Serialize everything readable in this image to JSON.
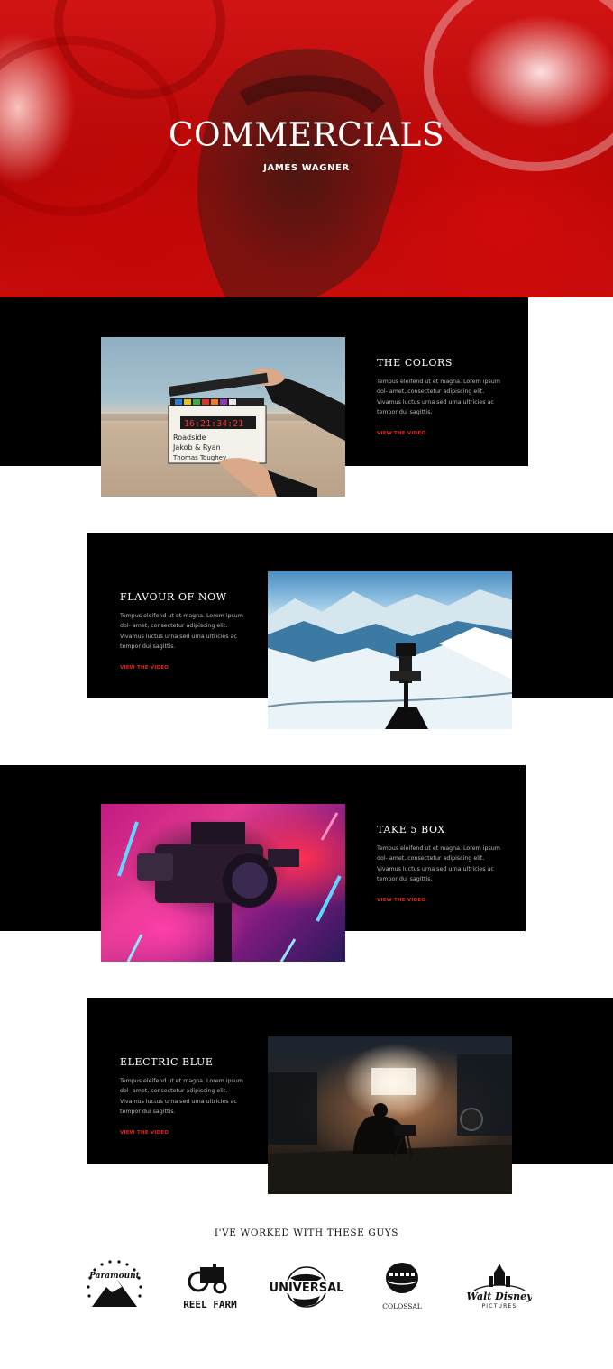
{
  "hero": {
    "title": "COMMERCIALS",
    "subtitle": "JAMES WAGNER"
  },
  "projects": [
    {
      "title": "THE COLORS",
      "text": "Tempus eleifend ut et magna. Lorem ipsum dol- amet, consectetur adipiscing elit. Vivamus luctus urna sed urna ultricies ac tempor dui sagittis.",
      "link": "VIEW THE VIDEO",
      "clapper_line1": "Roadside",
      "clapper_line2": "Jakob & Ryan",
      "clapper_line3": "Thomas Toughey",
      "clapper_time": "16:21:34:21"
    },
    {
      "title": "FLAVOUR OF NOW",
      "text": "Tempus eleifend ut et magna. Lorem ipsum dol- amet, consectetur adipiscing elit. Vivamus luctus urna sed urna ultricies ac tempor dui sagittis.",
      "link": "VIEW THE VIDEO"
    },
    {
      "title": "TAKE 5 BOX",
      "text": "Tempus eleifend ut et magna. Lorem ipsum dol- amet, consectetur adipiscing elit. Vivamus luctus urna sed urna ultricies ac tempor dui sagittis.",
      "link": "VIEW THE VIDEO"
    },
    {
      "title": "ELECTRIC BLUE",
      "text": "Tempus eleifend ut et magna. Lorem ipsum dol- amet, consectetur adipiscing elit. Vivamus luctus urna sed urna ultricies ac tempor dui sagittis.",
      "link": "VIEW THE VIDEO"
    }
  ],
  "clients": {
    "title": "I'VE WORKED WITH THESE GUYS",
    "logos": [
      {
        "name": "paramount-logo",
        "text": "Paramount"
      },
      {
        "name": "reel-farm-logo",
        "text": "REEL FARM"
      },
      {
        "name": "universal-logo",
        "text": "UNIVERSAL"
      },
      {
        "name": "colossal-logo",
        "text": "COLOSSAL"
      },
      {
        "name": "walt-disney-logo",
        "text": "Walt Disney",
        "sub": "PICTURES"
      }
    ]
  },
  "colors": {
    "accent": "#e0281b",
    "block": "#000000",
    "hero_red": "#c40808"
  }
}
